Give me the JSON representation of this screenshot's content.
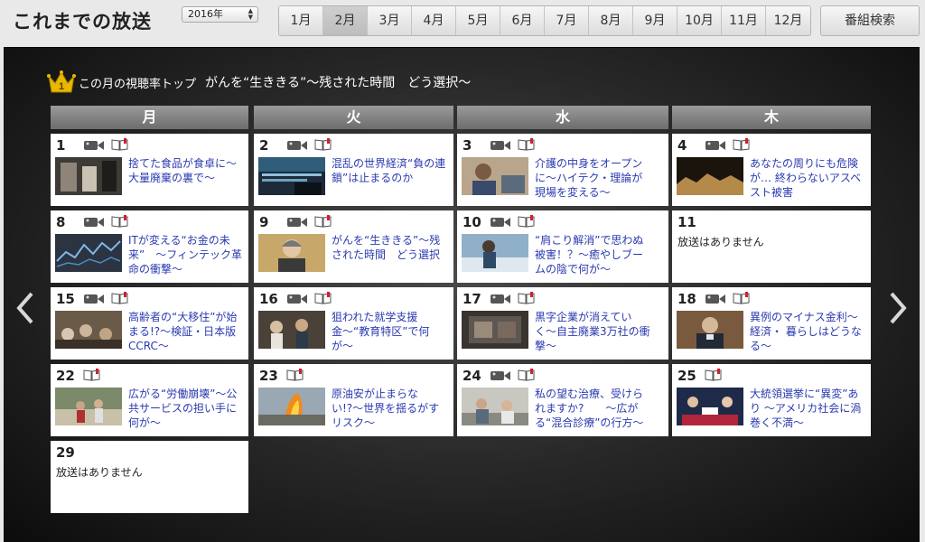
{
  "header": {
    "title": "これまでの放送",
    "year": "2016年",
    "months": [
      "1月",
      "2月",
      "3月",
      "4月",
      "5月",
      "6月",
      "7月",
      "8月",
      "9月",
      "10月",
      "11月",
      "12月"
    ],
    "active_month": "2月",
    "search_label": "番組検索"
  },
  "top": {
    "badge": "1",
    "label": "この月の視聴率トップ",
    "title": "がんを“生ききる”〜残された時間　どう選択〜"
  },
  "weekdays": [
    "月",
    "火",
    "水",
    "木"
  ],
  "days": [
    {
      "day": "1",
      "video": true,
      "text": true,
      "program": "捨てた食品が食卓に〜大量廃棄の裏で〜"
    },
    {
      "day": "2",
      "video": true,
      "text": true,
      "program": "混乱の世界経済“負の連鎖”は止まるのか"
    },
    {
      "day": "3",
      "video": true,
      "text": true,
      "program": "介護の中身をオープンに〜ハイテク・理論が現場を変える〜"
    },
    {
      "day": "4",
      "video": true,
      "text": true,
      "program": "あなたの周りにも危険が… 終わらないアスベスト被害"
    },
    {
      "day": "8",
      "video": true,
      "text": true,
      "program": "ITが変える“お金の未来”　〜フィンテック革命の衝撃〜"
    },
    {
      "day": "9",
      "video": true,
      "text": true,
      "program": "がんを“生ききる”〜残された時間　どう選択"
    },
    {
      "day": "10",
      "video": true,
      "text": true,
      "program": "“肩こり解消”で思わぬ被害！？〜癒やしブームの陰で何が〜"
    },
    {
      "day": "11",
      "video": false,
      "text": false,
      "none": "放送はありません"
    },
    {
      "day": "15",
      "video": true,
      "text": true,
      "program": "高齢者の“大移住”が始まる!?〜検証・日本版CCRC〜"
    },
    {
      "day": "16",
      "video": true,
      "text": true,
      "program": "狙われた就学支援金〜“教育特区”で何が〜"
    },
    {
      "day": "17",
      "video": true,
      "text": true,
      "program": "黒字企業が消えていく〜自主廃業3万社の衝撃〜"
    },
    {
      "day": "18",
      "video": true,
      "text": true,
      "program": "異例のマイナス金利〜経済・ 暮らしはどうなる〜"
    },
    {
      "day": "22",
      "video": false,
      "text": true,
      "program": "広がる“労働崩壊”〜公共サービスの担い手に何が〜"
    },
    {
      "day": "23",
      "video": false,
      "text": true,
      "program": "原油安が止まらない!?〜世界を揺るがすリスク〜"
    },
    {
      "day": "24",
      "video": true,
      "text": true,
      "program": "私の望む治療、受けられますか?　　〜広がる“混合診療”の行方〜"
    },
    {
      "day": "25",
      "video": false,
      "text": true,
      "program": "大統領選挙に“異変”あり 〜アメリカ社会に渦巻く不満〜"
    },
    {
      "day": "29",
      "video": false,
      "text": false,
      "none": "放送はありません"
    }
  ],
  "icons": {
    "video": "video-camera-icon",
    "text": "open-book-icon",
    "crown": "crown-icon",
    "prev": "chevron-left-icon",
    "next": "chevron-right-icon"
  },
  "colors": {
    "link": "#2a3ab0",
    "crown": "#e8b800",
    "book_accent": "#d0202a"
  }
}
